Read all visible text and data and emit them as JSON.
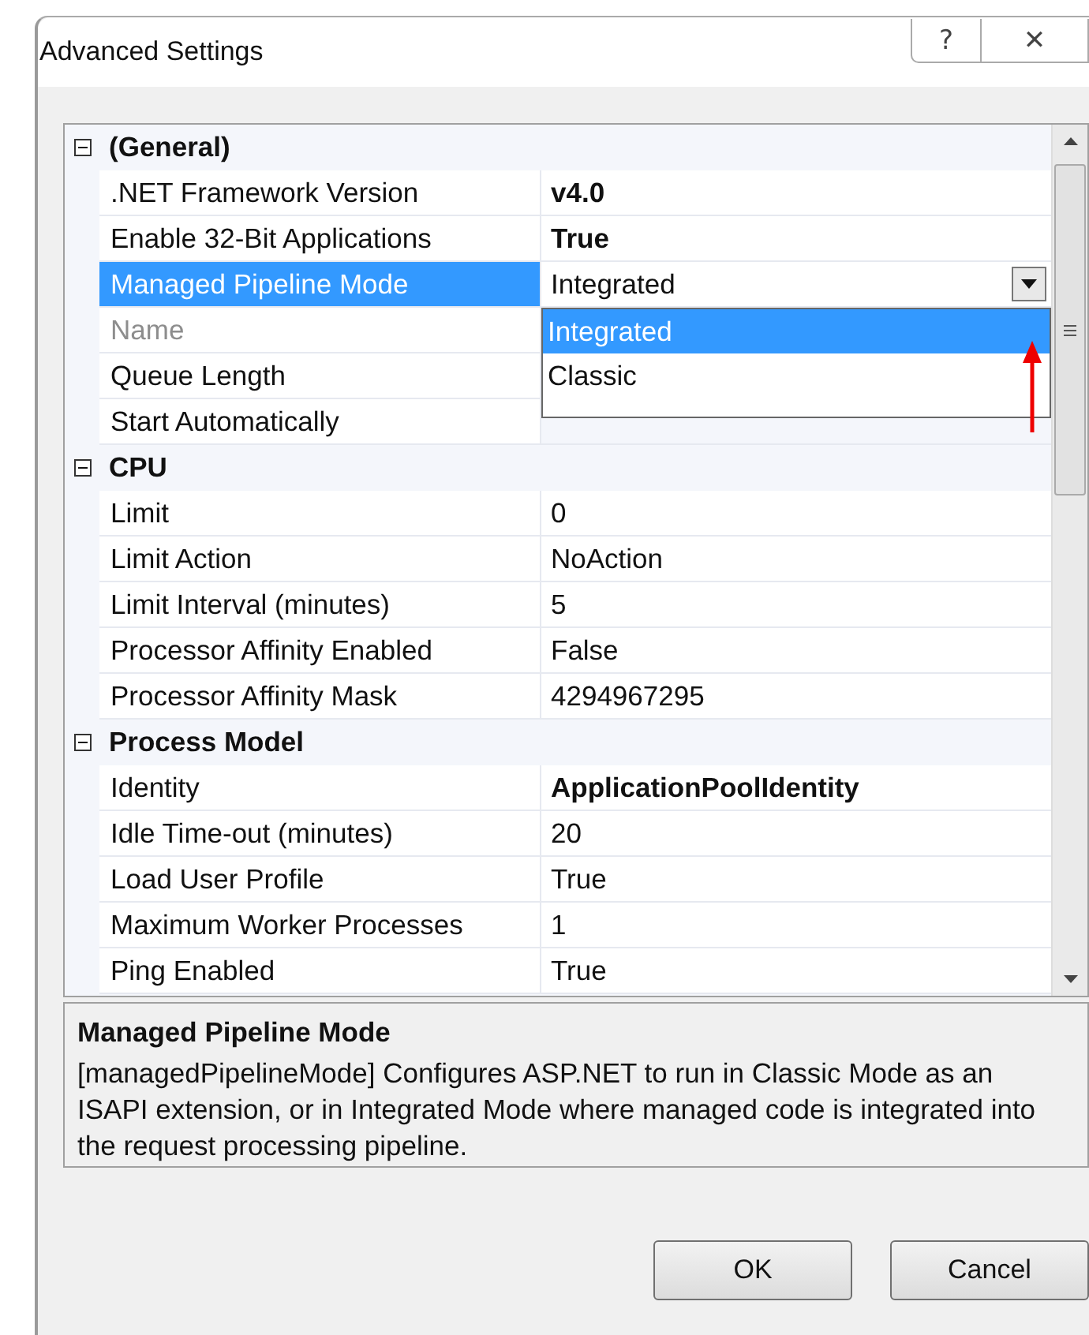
{
  "window": {
    "title": "Advanced Settings",
    "help_button": "?",
    "close_button": "✕"
  },
  "grid": {
    "categories": [
      {
        "name": "(General)",
        "expanded": true,
        "properties": [
          {
            "name": ".NET Framework Version",
            "value": "v4.0",
            "bold": true,
            "selected": false,
            "disabled": false
          },
          {
            "name": "Enable 32-Bit Applications",
            "value": "True",
            "bold": true,
            "selected": false,
            "disabled": false
          },
          {
            "name": "Managed Pipeline Mode",
            "value": "Integrated",
            "bold": false,
            "selected": true,
            "disabled": false,
            "dropdown": {
              "options": [
                {
                  "label": "Integrated",
                  "selected": true
                },
                {
                  "label": "Classic",
                  "selected": false
                }
              ]
            }
          },
          {
            "name": "Name",
            "selected": false,
            "disabled": true
          },
          {
            "name": "Queue Length",
            "selected": false,
            "disabled": false
          },
          {
            "name": "Start Automatically",
            "selected": false,
            "disabled": false
          }
        ]
      },
      {
        "name": "CPU",
        "expanded": true,
        "properties": [
          {
            "name": "Limit",
            "value": "0",
            "bold": false,
            "selected": false,
            "disabled": false
          },
          {
            "name": "Limit Action",
            "value": "NoAction",
            "bold": false,
            "selected": false,
            "disabled": false
          },
          {
            "name": "Limit Interval (minutes)",
            "value": "5",
            "bold": false,
            "selected": false,
            "disabled": false
          },
          {
            "name": "Processor Affinity Enabled",
            "value": "False",
            "bold": false,
            "selected": false,
            "disabled": false
          },
          {
            "name": "Processor Affinity Mask",
            "value": "4294967295",
            "bold": false,
            "selected": false,
            "disabled": false
          }
        ]
      },
      {
        "name": "Process Model",
        "expanded": true,
        "properties": [
          {
            "name": "Identity",
            "value": "ApplicationPoolIdentity",
            "bold": true,
            "selected": false,
            "disabled": false
          },
          {
            "name": "Idle Time-out (minutes)",
            "value": "20",
            "bold": false,
            "selected": false,
            "disabled": false
          },
          {
            "name": "Load User Profile",
            "value": "True",
            "bold": false,
            "selected": false,
            "disabled": false
          },
          {
            "name": "Maximum Worker Processes",
            "value": "1",
            "bold": false,
            "selected": false,
            "disabled": false
          },
          {
            "name": "Ping Enabled",
            "value": "True",
            "bold": false,
            "selected": false,
            "disabled": false
          }
        ]
      }
    ]
  },
  "description": {
    "title": "Managed Pipeline Mode",
    "text": "[managedPipelineMode] Configures ASP.NET to run in Classic Mode as an ISAPI extension, or in Integrated Mode where managed code is integrated into the request processing pipeline."
  },
  "buttons": [
    "OK",
    "Cancel"
  ]
}
